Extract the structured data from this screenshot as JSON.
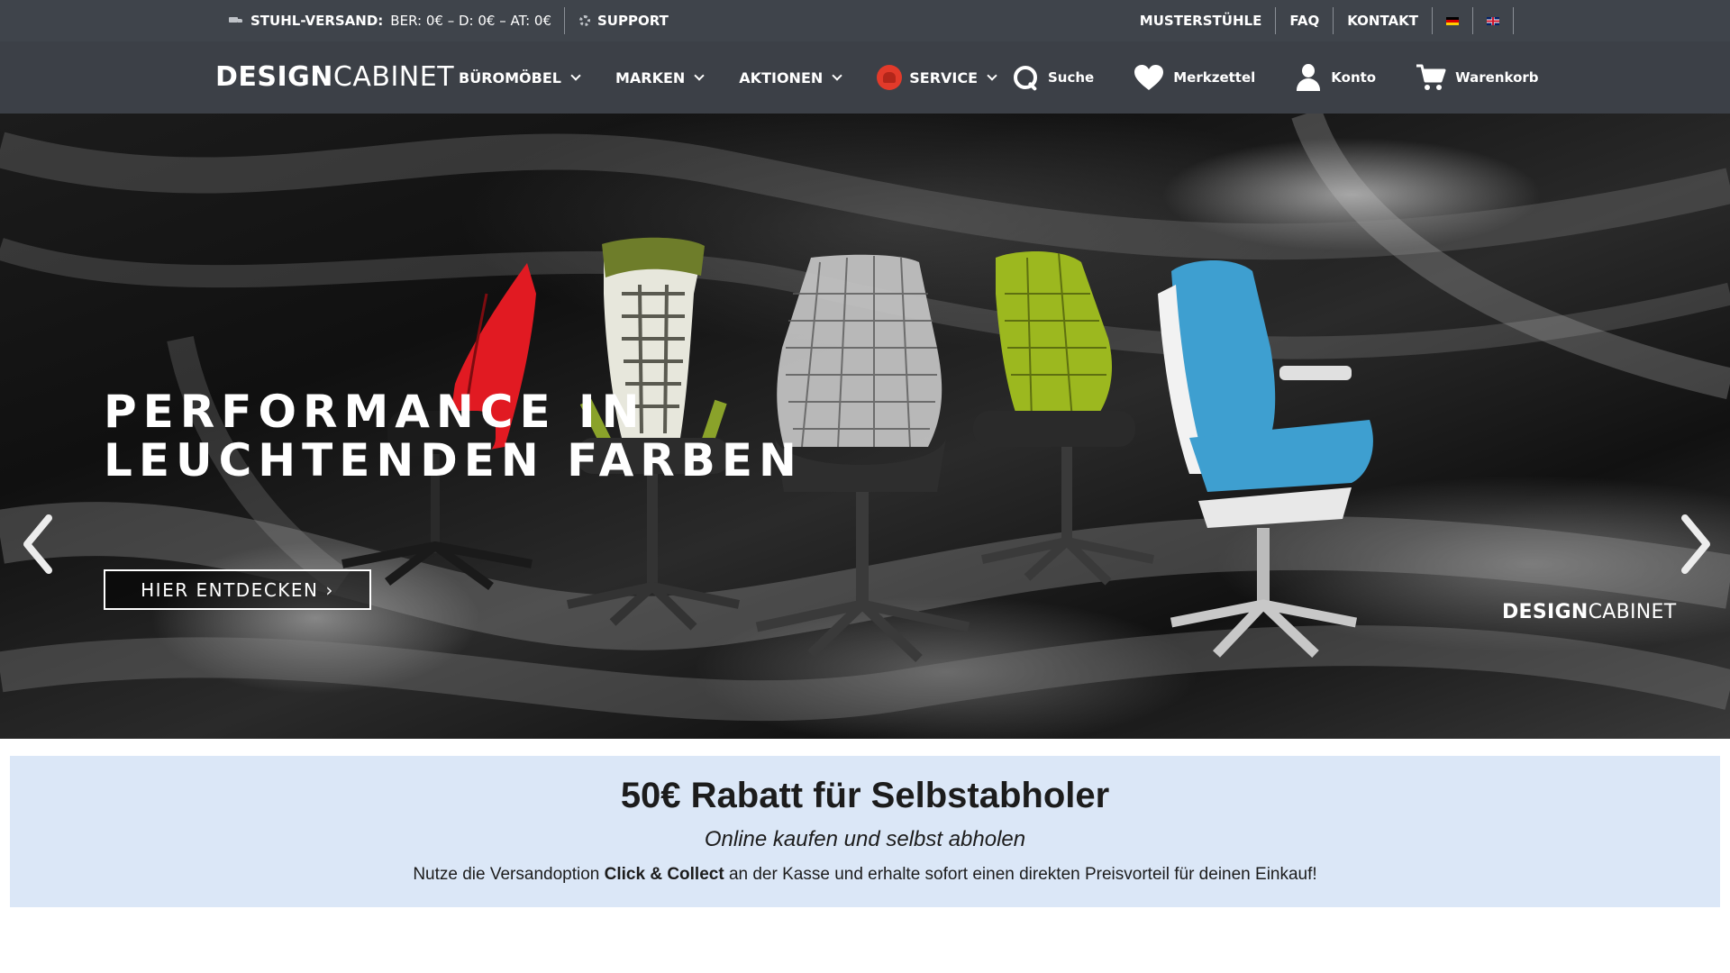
{
  "topbar": {
    "shipping_label": "STUHL-VERSAND:",
    "shipping_value": "BER: 0€ – D: 0€ – AT: 0€",
    "support_label": "SUPPORT",
    "links": [
      {
        "label": "MUSTERSTÜHLE"
      },
      {
        "label": "FAQ"
      },
      {
        "label": "KONTAKT"
      }
    ],
    "languages": [
      "de",
      "en"
    ]
  },
  "nav": {
    "logo_bold": "DESIGN",
    "logo_light": "CABINET",
    "menu": [
      {
        "label": "BÜROMÖBEL"
      },
      {
        "label": "MARKEN"
      },
      {
        "label": "AKTIONEN"
      },
      {
        "label": "SERVICE",
        "icon": "service-chair-icon"
      }
    ],
    "tools": [
      {
        "label": "Suche",
        "icon": "search-icon"
      },
      {
        "label": "Merkzettel",
        "icon": "heart-icon"
      },
      {
        "label": "Konto",
        "icon": "user-icon"
      },
      {
        "label": "Warenkorb",
        "icon": "cart-icon"
      }
    ]
  },
  "hero": {
    "title_line1": "PERFORMANCE IN",
    "title_line2": "LEUCHTENDEN FARBEN",
    "cta": "HIER ENTDECKEN ›",
    "brand_bold": "DESIGN",
    "brand_light": "CABINET",
    "colors": {
      "red": "#e11a22",
      "green": "#9cb81f",
      "blue": "#3e9fd0",
      "olive": "#7a8a2a"
    }
  },
  "promo": {
    "title": "50€ Rabatt für Selbstabholer",
    "subtitle": "Online kaufen und selbst abholen",
    "text_before": "Nutze die Versandoption ",
    "text_bold": "Click & Collect",
    "text_after": " an der Kasse und erhalte sofort einen direkten Preisvorteil für deinen Einkauf!",
    "background": "#dbe7f7"
  }
}
